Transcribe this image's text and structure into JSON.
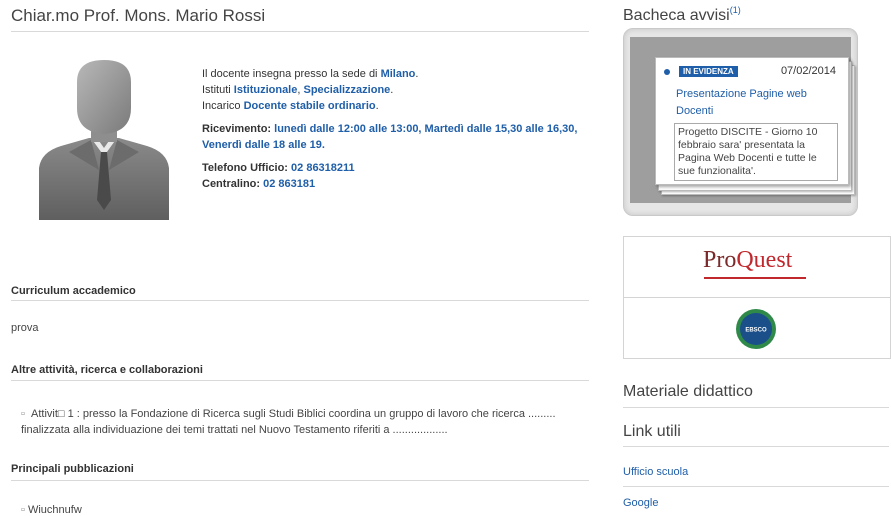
{
  "page_title": "Chiar.mo Prof. Mons. Mario Rossi",
  "profile": {
    "line1_prefix": "Il docente insegna presso la sede di ",
    "line1_city": "Milano",
    "line1_suffix": ".",
    "line2_prefix": "Istituti ",
    "line2_inst1": "Istituzionale",
    "line2_sep": ", ",
    "line2_inst2": "Specializzazione",
    "line2_suffix": ".",
    "line3_prefix": "Incarico ",
    "line3_role": "Docente stabile ordinario",
    "line3_suffix": ".",
    "ricevimento_label": "Ricevimento:",
    "ricevimento_value": "lunedì dalle 12:00 alle 13:00, Martedì dalle 15,30 alle 16,30, Venerdì dalle 18 alle 19.",
    "telefono_label": "Telefono Ufficio:",
    "telefono_value": "02 86318211",
    "centralino_label": "Centralino:",
    "centralino_value": "02 863181"
  },
  "sections": {
    "curriculum_title": "Curriculum accademico",
    "curriculum_text": "prova",
    "altre_title": "Altre attività, ricerca e collaborazioni",
    "altre_item": "Attivit□ 1 : presso la Fondazione di Ricerca sugli Studi Biblici coordina un gruppo di lavoro che ricerca ......... finalizzata alla individuazione dei temi trattati nel Nuovo Testamento riferiti a ..................",
    "pubblicazioni_title": "Principali pubblicazioni",
    "pubblicazioni_first": "Wiuchnufw"
  },
  "bacheca": {
    "title": "Bacheca avvisi",
    "title_sup": "(1)",
    "badge": "IN EVIDENZA",
    "date": "07/02/2014",
    "card_title": "Presentazione Pagine web Docenti",
    "card_body": "Progetto DISCITE - Giorno 10 febbraio sara' presentata la Pagina Web Docenti e tutte le sue funzionalita'."
  },
  "logos": {
    "proquest_pro": "Pro",
    "proquest_quest": "Quest",
    "ebsco_text": "EBSCO"
  },
  "materiale": {
    "title": "Materiale didattico"
  },
  "link_utili": {
    "title": "Link utili",
    "items": [
      "Ufficio scuola",
      "Google"
    ]
  },
  "colors": {
    "link": "#1f5ea8",
    "badge_bg": "#1f5ea8",
    "proquest_red": "#c0282d"
  }
}
